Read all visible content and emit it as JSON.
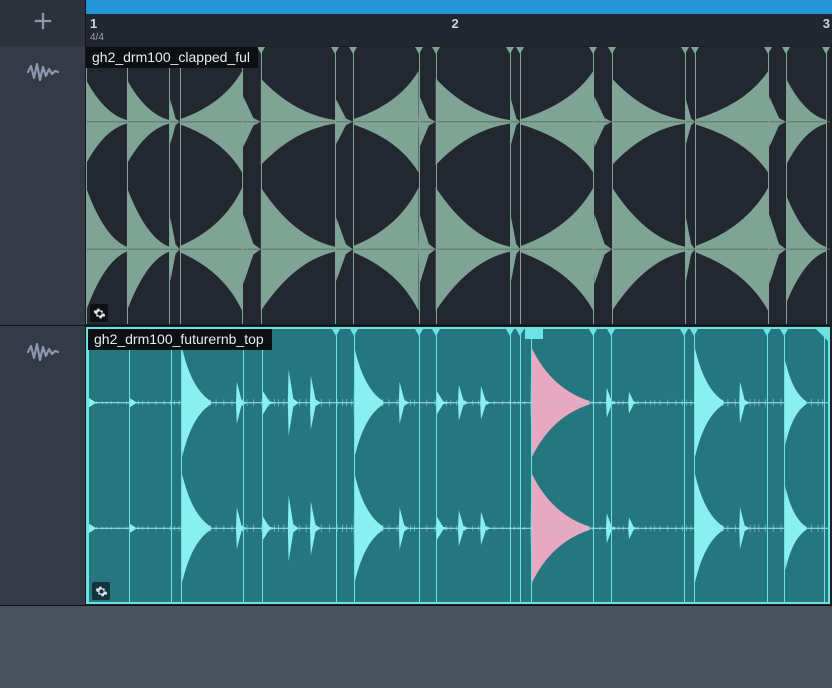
{
  "ruler": {
    "bar1": "1",
    "bar2": "2",
    "bar3": "3",
    "sig": "4/4"
  },
  "tracks": [
    {
      "clip_name": "gh2_drm100_clapped_ful",
      "waveform_color": "#7fa394",
      "bg": "#23272f",
      "slice_color": "#7fa394",
      "slices_pct": [
        0,
        5.5,
        11.2,
        12.6,
        21,
        23.5,
        33.5,
        35.9,
        44.7,
        47,
        57,
        58.4,
        68.2,
        70.7,
        80.5,
        81.9,
        91.7,
        94.1,
        99.5
      ],
      "segments": [
        {
          "x": 0,
          "w": 5.5,
          "amp": [
            0.66,
            0.97
          ],
          "shape": "decay"
        },
        {
          "x": 5.5,
          "w": 5.7,
          "amp": [
            0.66,
            0.97
          ],
          "shape": "decay"
        },
        {
          "x": 11.2,
          "w": 1.4,
          "amp": [
            0.35,
            0.5
          ],
          "shape": "spike"
        },
        {
          "x": 12.6,
          "w": 8.4,
          "amp": [
            0.8,
            0.97
          ],
          "shape": "attack"
        },
        {
          "x": 21,
          "w": 2.5,
          "amp": [
            0.4,
            0.55
          ],
          "shape": "spike"
        },
        {
          "x": 23.5,
          "w": 10,
          "amp": [
            0.68,
            0.97
          ],
          "shape": "decay"
        },
        {
          "x": 33.5,
          "w": 2.4,
          "amp": [
            0.35,
            0.5
          ],
          "shape": "spike"
        },
        {
          "x": 35.9,
          "w": 8.8,
          "amp": [
            0.8,
            0.97
          ],
          "shape": "attack"
        },
        {
          "x": 44.7,
          "w": 2.3,
          "amp": [
            0.4,
            0.55
          ],
          "shape": "spike"
        },
        {
          "x": 47,
          "w": 10,
          "amp": [
            0.68,
            0.97
          ],
          "shape": "decay"
        },
        {
          "x": 57,
          "w": 1.4,
          "amp": [
            0.35,
            0.5
          ],
          "shape": "spike"
        },
        {
          "x": 58.4,
          "w": 9.8,
          "amp": [
            0.8,
            0.97
          ],
          "shape": "attack"
        },
        {
          "x": 68.2,
          "w": 2.5,
          "amp": [
            0.4,
            0.55
          ],
          "shape": "spike"
        },
        {
          "x": 70.7,
          "w": 9.8,
          "amp": [
            0.68,
            0.97
          ],
          "shape": "decay"
        },
        {
          "x": 80.5,
          "w": 1.4,
          "amp": [
            0.35,
            0.5
          ],
          "shape": "spike"
        },
        {
          "x": 81.9,
          "w": 9.8,
          "amp": [
            0.8,
            0.97
          ],
          "shape": "attack"
        },
        {
          "x": 91.7,
          "w": 2.4,
          "amp": [
            0.4,
            0.55
          ],
          "shape": "spike"
        },
        {
          "x": 94.1,
          "w": 5.4,
          "amp": [
            0.68,
            0.85
          ],
          "shape": "decay"
        }
      ]
    },
    {
      "clip_name": "gh2_drm100_futurernb_top",
      "waveform_color": "#8af0ef",
      "accent_color": "#e7a9c2",
      "bg": "#267680",
      "slice_color": "#6be3e4",
      "slices_pct": [
        0,
        5.5,
        11.2,
        12.6,
        21,
        23.5,
        33.5,
        35.9,
        44.7,
        47,
        57,
        58.4,
        59.8,
        68.2,
        70.7,
        80.5,
        81.9,
        91.7,
        94.1,
        99.5
      ],
      "hits": [
        {
          "x": 0,
          "w": 2,
          "h": 0.08
        },
        {
          "x": 5.5,
          "w": 2,
          "h": 0.08
        },
        {
          "x": 12.6,
          "w": 4,
          "h": 0.9,
          "big": true
        },
        {
          "x": 20,
          "w": 1.5,
          "h": 0.35
        },
        {
          "x": 23.5,
          "w": 2,
          "h": 0.2
        },
        {
          "x": 27,
          "w": 1.5,
          "h": 0.55
        },
        {
          "x": 30,
          "w": 1.5,
          "h": 0.45
        },
        {
          "x": 35.9,
          "w": 4,
          "h": 0.9,
          "big": true
        },
        {
          "x": 42,
          "w": 1.5,
          "h": 0.35
        },
        {
          "x": 47,
          "w": 2,
          "h": 0.2
        },
        {
          "x": 50,
          "w": 1.5,
          "h": 0.3
        },
        {
          "x": 53,
          "w": 1.5,
          "h": 0.28
        },
        {
          "x": 59.8,
          "w": 8,
          "h": 0.92,
          "big": true,
          "accent": true
        },
        {
          "x": 70,
          "w": 1.5,
          "h": 0.25
        },
        {
          "x": 73,
          "w": 1.5,
          "h": 0.18
        },
        {
          "x": 81.9,
          "w": 4,
          "h": 0.9,
          "big": true
        },
        {
          "x": 88,
          "w": 1.5,
          "h": 0.35
        },
        {
          "x": 94.1,
          "w": 3,
          "h": 0.7,
          "big": true
        }
      ],
      "playhead_cue_pct": 59
    }
  ],
  "gear_icon": "gear-icon",
  "bottom_fill": "#4a5260"
}
